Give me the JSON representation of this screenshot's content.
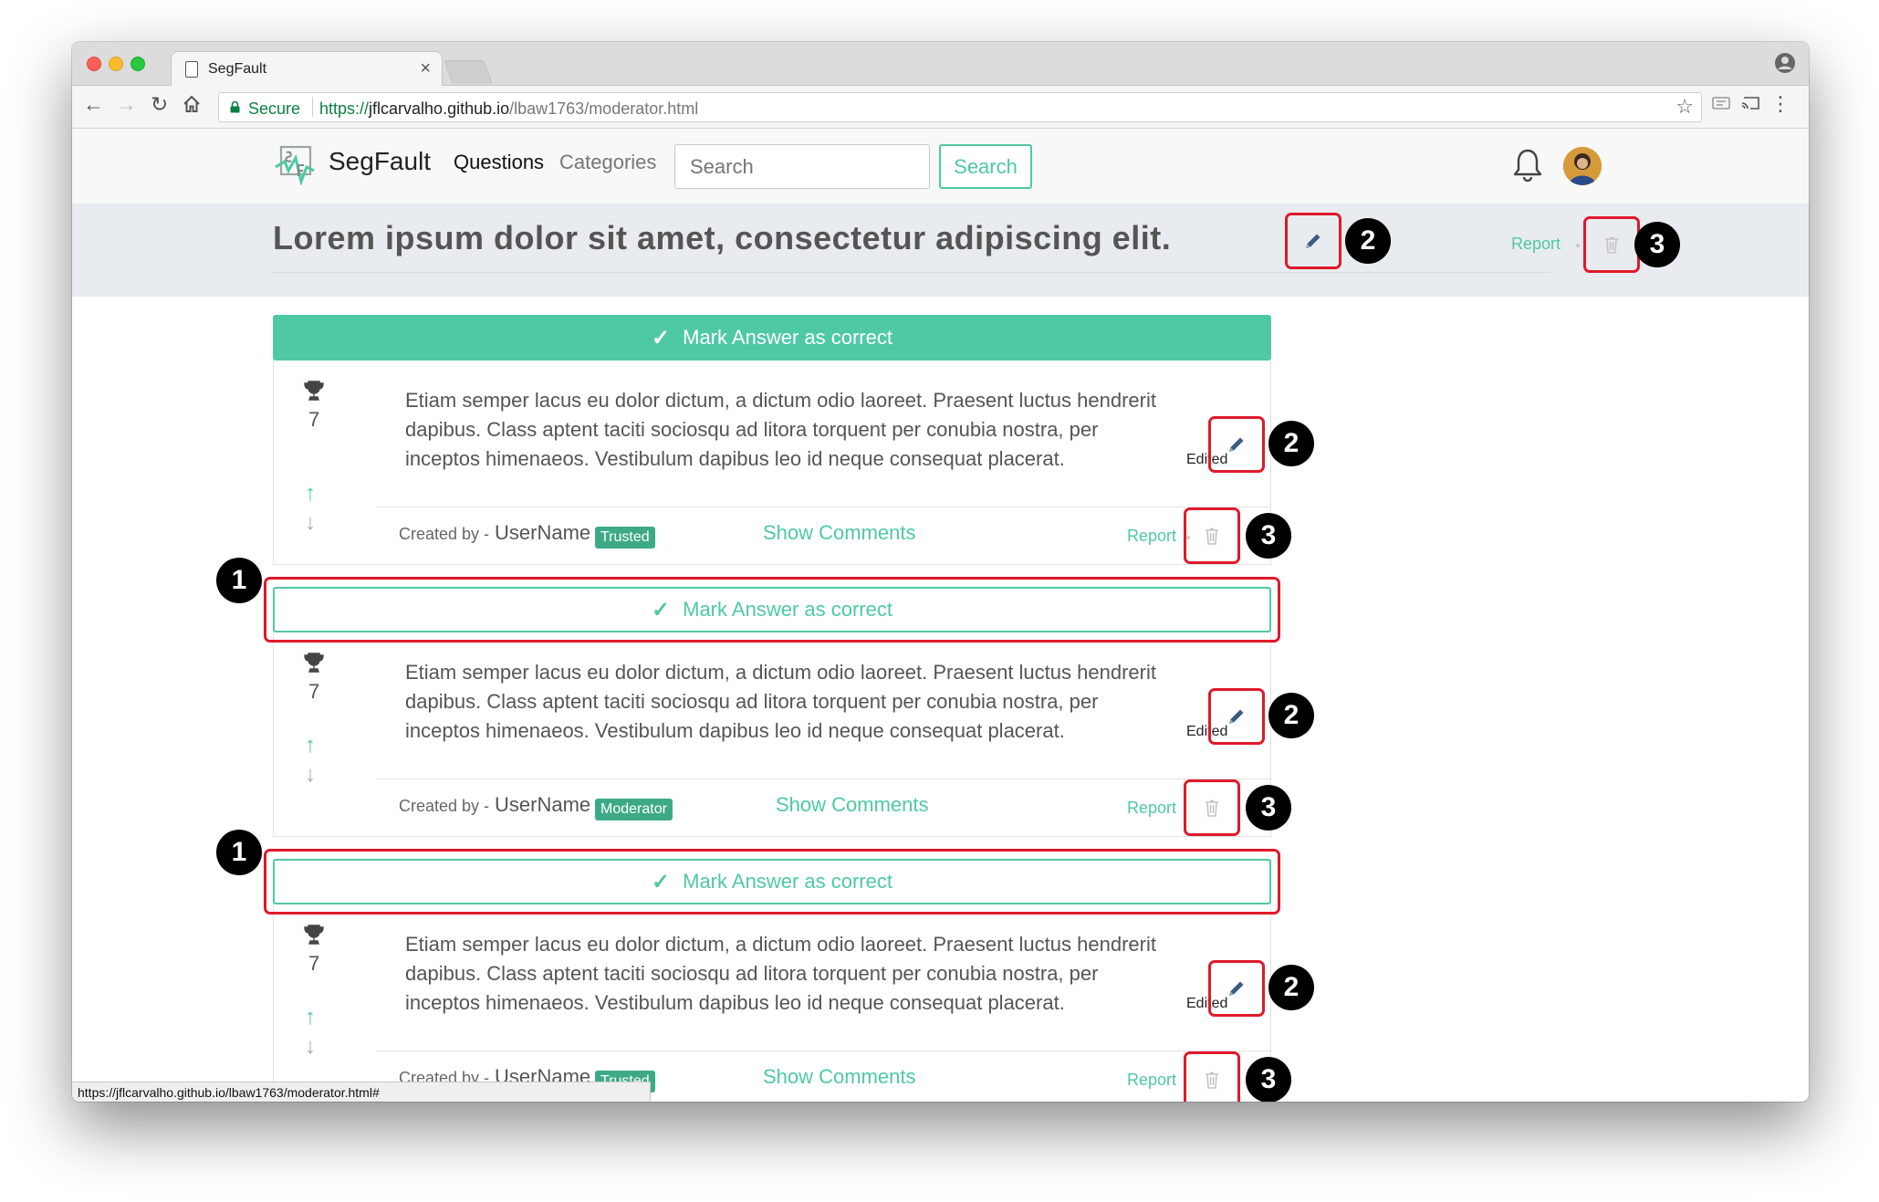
{
  "browser": {
    "tab_title": "SegFault",
    "tab_close": "×",
    "secure_label": "Secure",
    "url_scheme": "https://",
    "url_host": "jflcarvalho.github.io",
    "url_path": "/lbaw1763/moderator.html",
    "status_url": "https://jflcarvalho.github.io/lbaw1763/moderator.html#"
  },
  "nav": {
    "brand": "SegFault",
    "questions": "Questions",
    "categories": "Categories",
    "search_placeholder": "Search",
    "search_button": "Search"
  },
  "question": {
    "title": "Lorem ipsum dolor sit amet, consectetur adipiscing elit.",
    "report": "Report"
  },
  "callouts": {
    "one": "1",
    "two": "2",
    "three": "3"
  },
  "answers": [
    {
      "mark_label": "Mark Answer as correct",
      "score": "7",
      "body": "Etiam semper lacus eu dolor dictum, a dictum odio laoreet. Praesent luctus hendrerit dapibus. Class aptent taciti sociosqu ad litora torquent per conubia nostra, per inceptos himenaeos. Vestibulum dapibus leo id neque consequat placerat.",
      "edited": "Edited",
      "created_by": "Created by -",
      "username": "UserName",
      "role": "Trusted",
      "show_comments": "Show Comments",
      "report": "Report"
    },
    {
      "mark_label": "Mark Answer as correct",
      "score": "7",
      "body": "Etiam semper lacus eu dolor dictum, a dictum odio laoreet. Praesent luctus hendrerit dapibus. Class aptent taciti sociosqu ad litora torquent per conubia nostra, per inceptos himenaeos. Vestibulum dapibus leo id neque consequat placerat.",
      "edited": "Edited",
      "created_by": "Created by -",
      "username": "UserName",
      "role": "Moderator",
      "show_comments": "Show Comments",
      "report": "Report"
    },
    {
      "mark_label": "Mark Answer as correct",
      "score": "7",
      "body": "Etiam semper lacus eu dolor dictum, a dictum odio laoreet. Praesent luctus hendrerit dapibus. Class aptent taciti sociosqu ad litora torquent per conubia nostra, per inceptos himenaeos. Vestibulum dapibus leo id neque consequat placerat.",
      "edited": "Edited",
      "created_by": "Created by -",
      "username": "UserName",
      "role": "Trusted",
      "show_comments": "Show Comments",
      "report": "Report"
    }
  ],
  "colors": {
    "accent": "#4ec9a3",
    "badge": "#3daa86",
    "highlight": "#e0192a"
  },
  "icons": [
    "page-icon",
    "back-icon",
    "forward-icon",
    "reload-icon",
    "home-icon",
    "lock-icon",
    "star-icon",
    "cast-icon",
    "menu-icon",
    "bell-icon",
    "pencil-icon",
    "trash-icon",
    "trophy-icon",
    "arrow-up-icon",
    "arrow-down-icon",
    "check-icon"
  ]
}
